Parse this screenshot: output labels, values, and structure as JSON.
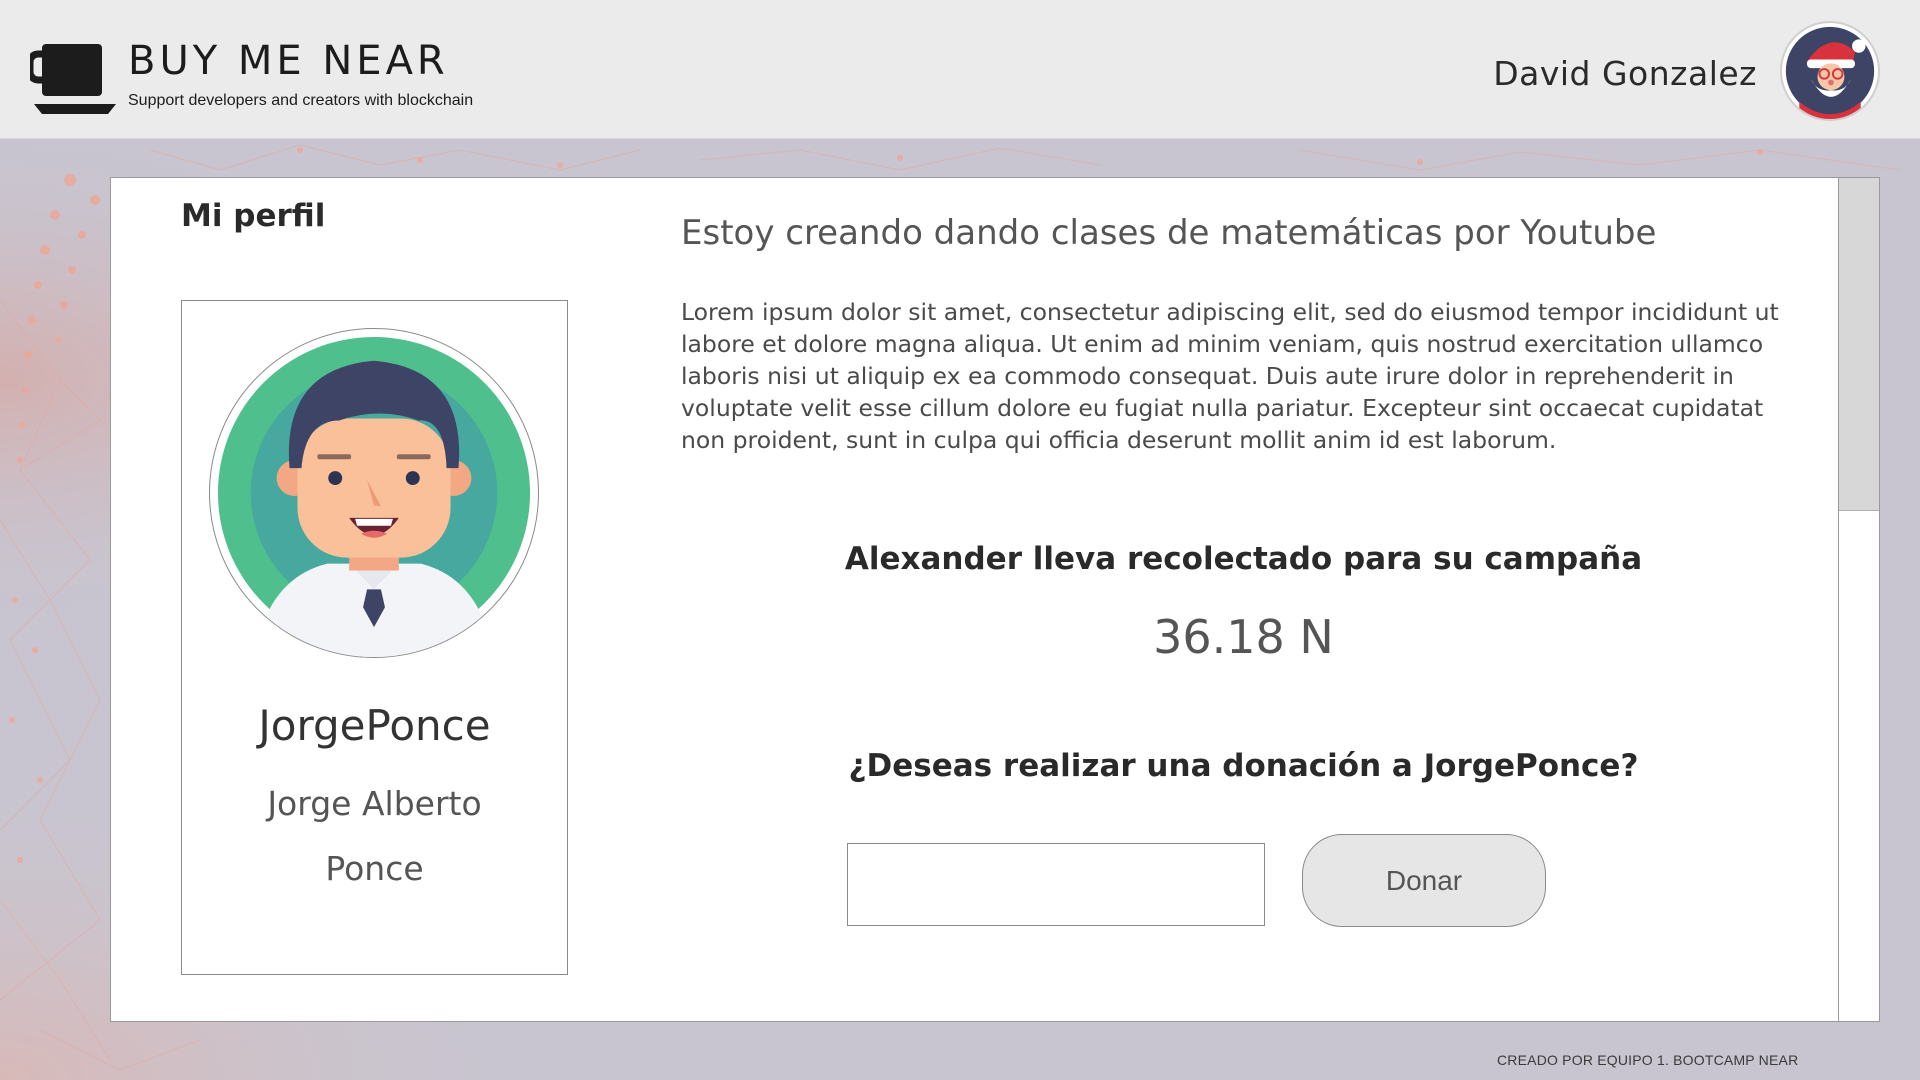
{
  "header": {
    "brand_title": "BUY ME NEAR",
    "brand_tagline": "Support developers and creators with blockchain",
    "logo_icon": "coffee-cup-icon",
    "user_name": "David Gonzalez",
    "user_avatar_icon": "santa-avatar-icon"
  },
  "profile": {
    "section_title": "Mi perfil",
    "avatar_icon": "man-avatar-icon",
    "username": "JorgePonce",
    "fullname": "Jorge Alberto Ponce"
  },
  "campaign": {
    "title": "Estoy creando dando clases de matemáticas por Youtube",
    "description": "Lorem ipsum dolor sit amet, consectetur adipiscing elit, sed do eiusmod tempor incididunt ut labore et dolore magna aliqua. Ut enim ad minim veniam, quis nostrud exercitation ullamco laboris nisi ut aliquip ex ea commodo consequat. Duis aute irure dolor in reprehenderit in voluptate velit esse cillum dolore eu fugiat nulla pariatur. Excepteur sint occaecat cupidatat non proident, sunt in culpa qui officia deserunt mollit anim id est laborum.",
    "raised_label": "Alexander lleva recolectado para su campaña",
    "raised_amount": "36.18 N"
  },
  "donation": {
    "question": "¿Deseas realizar una donación a JorgePonce?",
    "input_value": "",
    "button_label": "Donar"
  },
  "footer": {
    "text": "CREADO POR EQUIPO 1. BOOTCAMP NEAR"
  },
  "colors": {
    "header_bg": "#ebebeb",
    "page_bg": "#c9c6d1",
    "avatar_ring": "#4fc08d",
    "button_bg": "#e6e6e6"
  }
}
